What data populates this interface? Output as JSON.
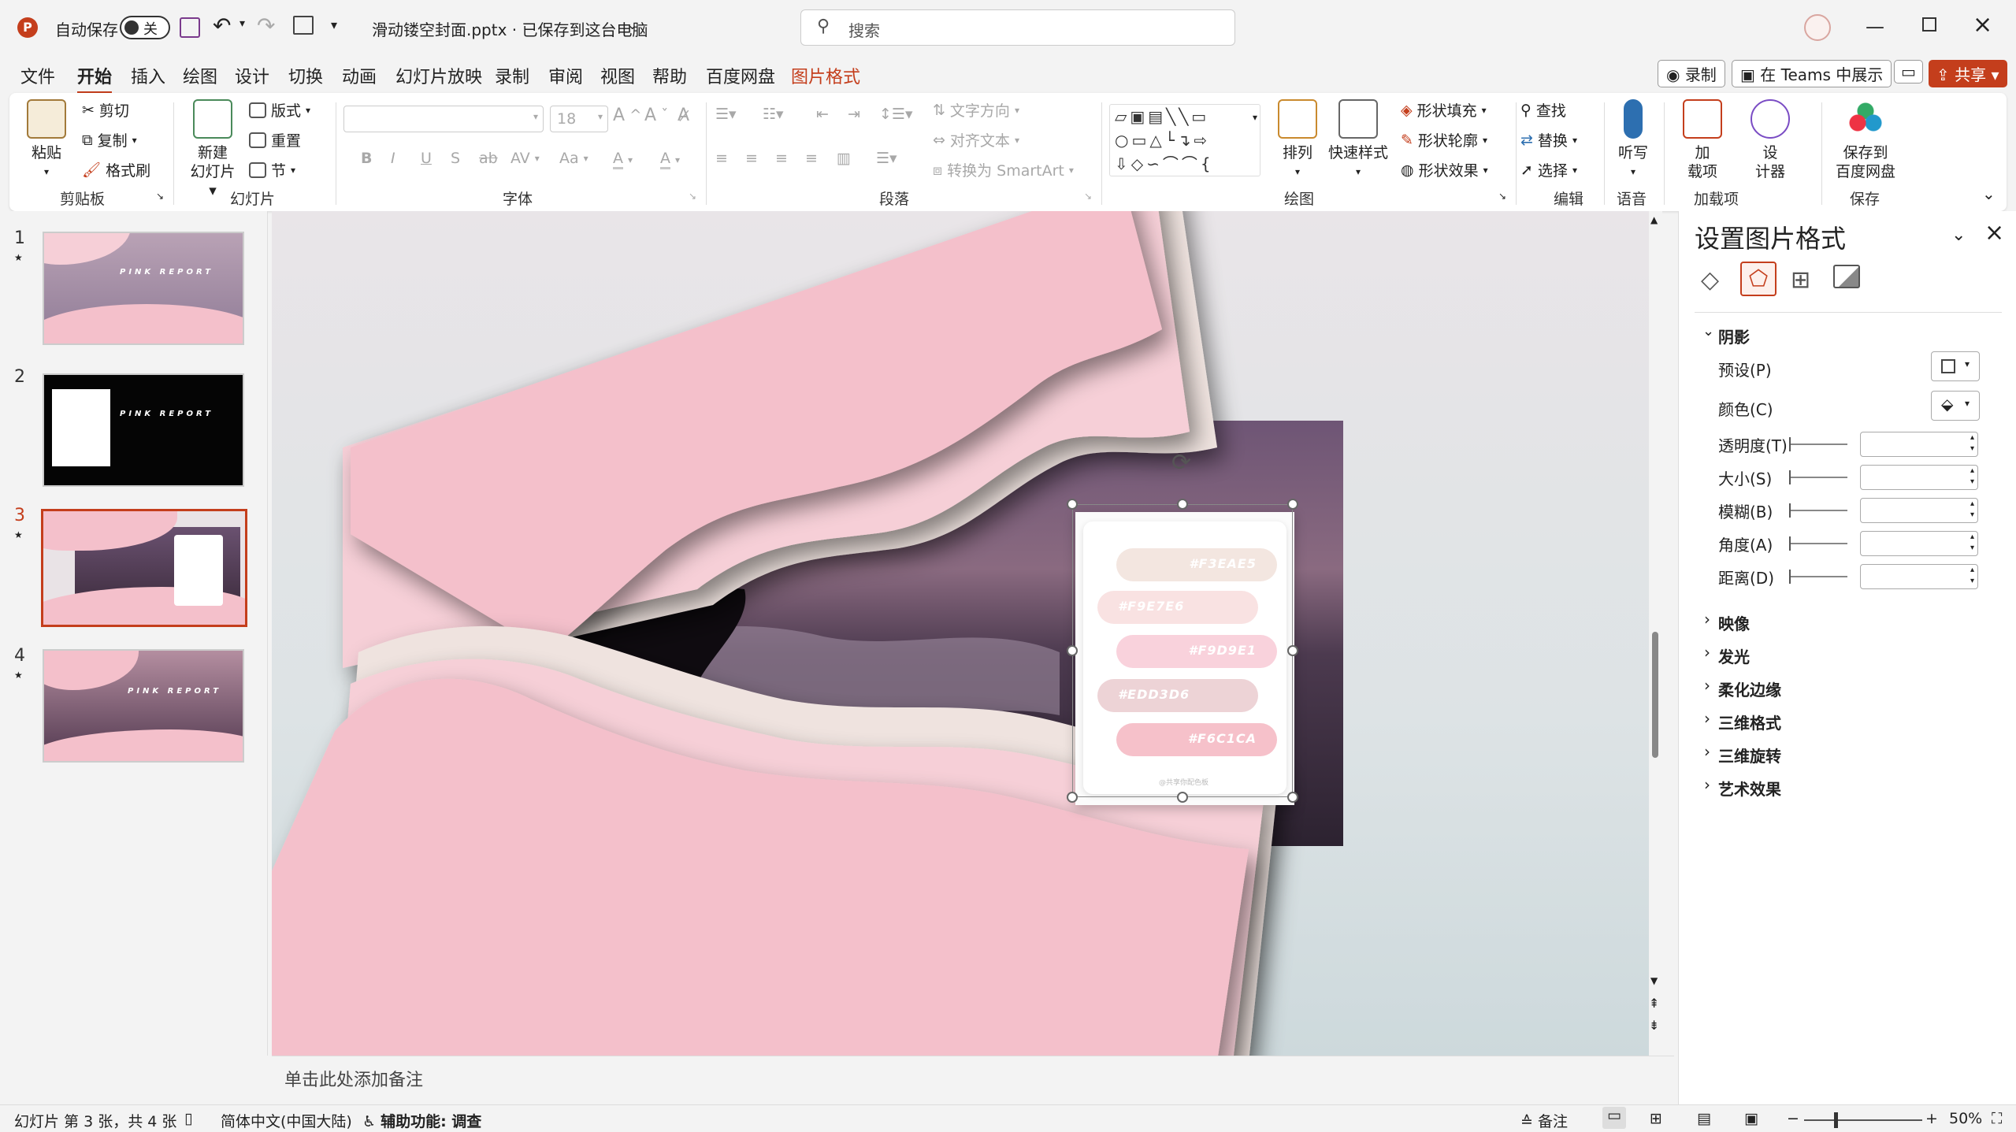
{
  "titlebar": {
    "autosave_label": "自动保存",
    "autosave_state": "关",
    "filename": "滑动镂空封面.pptx · 已保存到这台电脑",
    "search_placeholder": "搜索"
  },
  "menu": {
    "tabs": [
      "文件",
      "开始",
      "插入",
      "绘图",
      "设计",
      "切换",
      "动画",
      "幻灯片放映",
      "录制",
      "审阅",
      "视图",
      "帮助",
      "百度网盘",
      "图片格式"
    ],
    "active": "开始",
    "record_btn": "录制",
    "teams_btn": "在 Teams 中展示",
    "share_btn": "共享"
  },
  "ribbon": {
    "clipboard": {
      "paste": "粘贴",
      "cut": "剪切",
      "copy": "复制",
      "format_painter": "格式刷",
      "label": "剪贴板"
    },
    "slides": {
      "new_slide": "新建\n幻灯片",
      "layout": "版式",
      "reset": "重置",
      "section": "节",
      "label": "幻灯片"
    },
    "font": {
      "size": "18",
      "label": "字体",
      "bold": "B",
      "italic": "I",
      "underline": "U",
      "shadow": "S",
      "strike": "ab",
      "spacing": "AV",
      "case": "Aa",
      "highlight": "A",
      "color": "A"
    },
    "paragraph": {
      "text_direction": "文字方向",
      "align_text": "对齐文本",
      "smartart": "转换为 SmartArt",
      "label": "段落"
    },
    "drawing": {
      "arrange": "排列",
      "quick_styles": "快速样式",
      "shape_fill": "形状填充",
      "shape_outline": "形状轮廓",
      "shape_effects": "形状效果",
      "label": "绘图"
    },
    "editing": {
      "find": "查找",
      "replace": "替换",
      "select": "选择",
      "label": "编辑"
    },
    "voice": {
      "dictate": "听写",
      "label": "语音"
    },
    "addins": {
      "addins": "加\n载项",
      "designer": "设\n计器",
      "label": "加载项"
    },
    "save": {
      "save_baidu": "保存到\n百度网盘",
      "label": "保存"
    }
  },
  "thumbnails": [
    {
      "num": "1",
      "title": "PINK REPORT"
    },
    {
      "num": "2",
      "title": "PINK REPORT"
    },
    {
      "num": "3",
      "title": ""
    },
    {
      "num": "4",
      "title": "PINK REPORT"
    }
  ],
  "selected_slide": "3",
  "palette": {
    "swatches": [
      {
        "hex": "#F3EAE5",
        "color": "#f3e6e0"
      },
      {
        "hex": "#F9E7E6",
        "color": "#f9e2e2"
      },
      {
        "hex": "#F9D9E1",
        "color": "#f9d2dc"
      },
      {
        "hex": "#EDD3D6",
        "color": "#edd3d6"
      },
      {
        "hex": "#F6C1CA",
        "color": "#f6c1ca"
      }
    ],
    "footer": "@共享你配色板"
  },
  "notes_placeholder": "单击此处添加备注",
  "format_pane": {
    "title": "设置图片格式",
    "shadow_section": "阴影",
    "preset": "预设(P)",
    "color": "颜色(C)",
    "transparency": "透明度(T)",
    "size": "大小(S)",
    "blur": "模糊(B)",
    "angle": "角度(A)",
    "distance": "距离(D)",
    "sections": [
      "映像",
      "发光",
      "柔化边缘",
      "三维格式",
      "三维旋转",
      "艺术效果"
    ]
  },
  "statusbar": {
    "slide_info": "幻灯片 第 3 张，共 4 张",
    "language": "简体中文(中国大陆)",
    "accessibility": "辅助功能: 调查",
    "notes": "备注",
    "zoom": "50%"
  },
  "colors": {
    "accent": "#c43e1c",
    "pink": "#f4c0cb",
    "pink_light": "#f6cfd7",
    "cream": "#efe3df"
  }
}
